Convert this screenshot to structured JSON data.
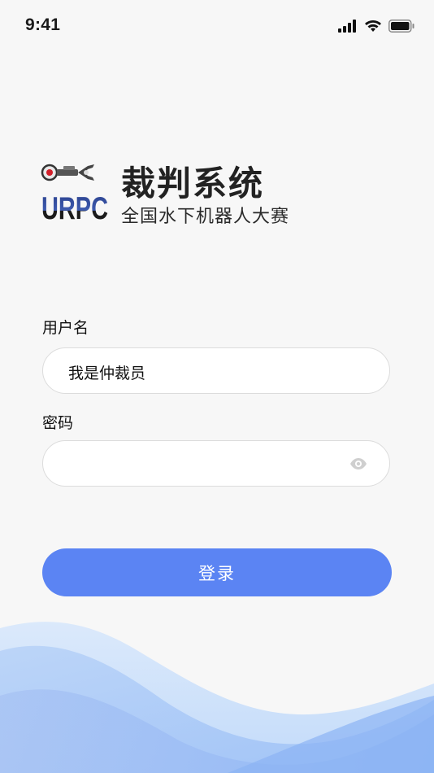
{
  "status_bar": {
    "time": "9:41",
    "icons": [
      "signal-icon",
      "wifi-icon",
      "battery-icon"
    ]
  },
  "header": {
    "logo_text": "URPC",
    "title": "裁判系统",
    "subtitle": "全国水下机器人大赛"
  },
  "form": {
    "username_label": "用户名",
    "username_value": "我是仲裁员",
    "password_label": "密码",
    "password_value": "",
    "password_toggle_icon": "eye-icon",
    "login_label": "登录"
  },
  "colors": {
    "accent": "#5b84f3",
    "background": "#f7f7f7",
    "wave_light": "#cfe3fb",
    "wave_mid": "#a8c8f7"
  }
}
